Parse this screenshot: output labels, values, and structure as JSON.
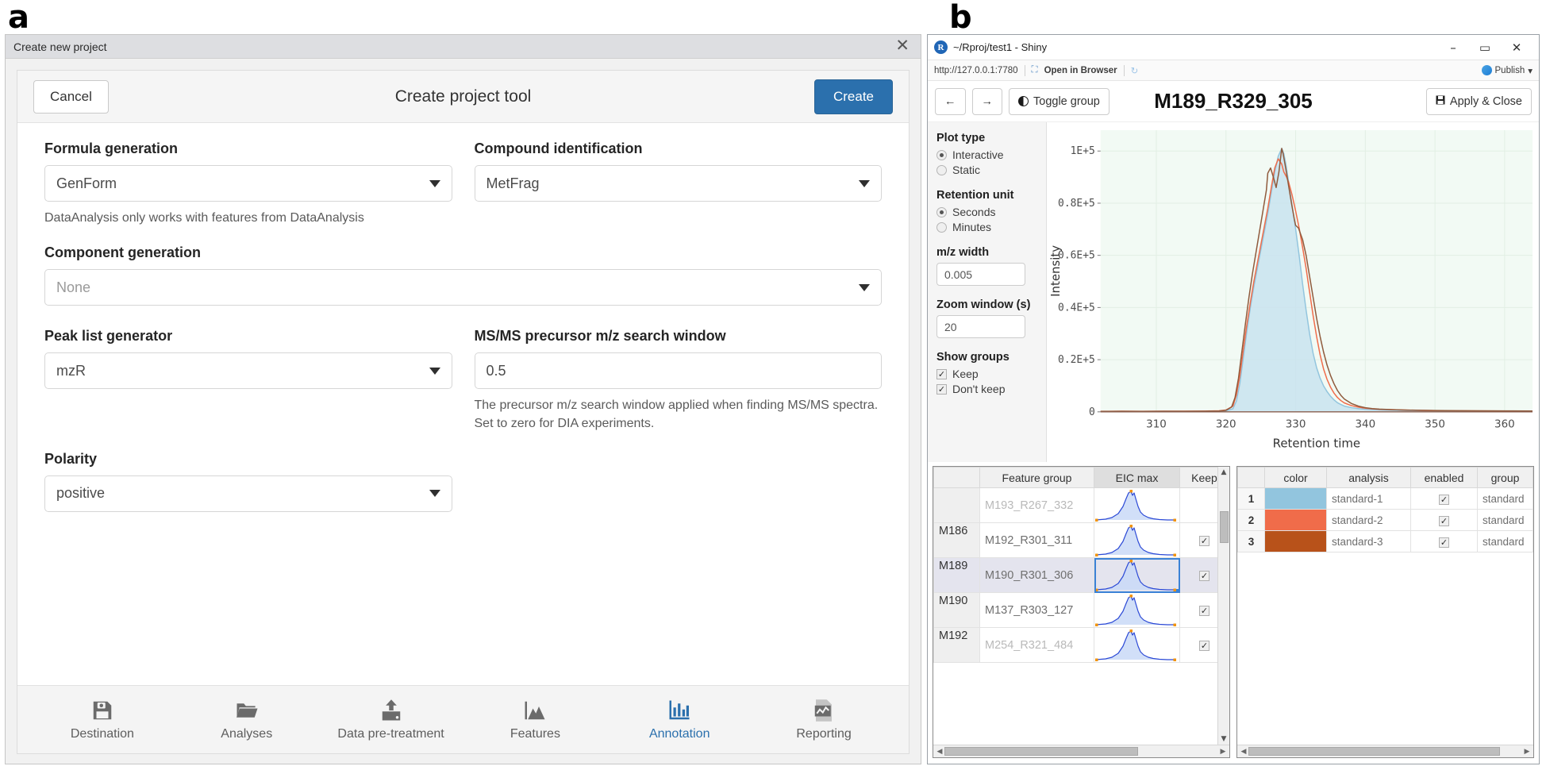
{
  "figure": {
    "label_a": "a",
    "label_b": "b"
  },
  "panel_a": {
    "window_title": "Create new project",
    "close_icon": "close-icon",
    "toolbar": {
      "cancel_label": "Cancel",
      "title": "Create project tool",
      "create_label": "Create"
    },
    "fields": {
      "formula_generation": {
        "label": "Formula generation",
        "value": "GenForm",
        "hint": "DataAnalysis only works with features from DataAnalysis"
      },
      "compound_identification": {
        "label": "Compound identification",
        "value": "MetFrag"
      },
      "component_generation": {
        "label": "Component generation",
        "value": "None"
      },
      "peak_list_generator": {
        "label": "Peak list generator",
        "value": "mzR"
      },
      "msms_precursor_window": {
        "label": "MS/MS precursor m/z search window",
        "value": "0.5",
        "hint": "The precursor m/z search window applied when finding MS/MS spectra. Set to zero for DIA experiments."
      },
      "polarity": {
        "label": "Polarity",
        "value": "positive"
      }
    },
    "bottom_tabs": [
      {
        "label": "Destination",
        "icon": "save-disk-icon",
        "active": false
      },
      {
        "label": "Analyses",
        "icon": "folder-open-icon",
        "active": false
      },
      {
        "label": "Data pre-treatment",
        "icon": "upload-icon",
        "active": false
      },
      {
        "label": "Features",
        "icon": "mountain-chart-icon",
        "active": false
      },
      {
        "label": "Annotation",
        "icon": "bar-chart-icon",
        "active": true
      },
      {
        "label": "Reporting",
        "icon": "report-document-icon",
        "active": false
      }
    ],
    "accent_color": "#2b70ad"
  },
  "panel_b": {
    "window_title": "~/Rproj/test1 - Shiny",
    "app_icon": "r-logo-icon",
    "window_controls": {
      "minimize": "–",
      "maximize": "▭",
      "close": "✕"
    },
    "url_bar": {
      "url": "http://127.0.0.1:7780",
      "open_in_browser": "Open in Browser",
      "refresh_icon": "refresh-icon",
      "publish_label": "Publish",
      "publish_caret": "▾"
    },
    "app_toolbar": {
      "back_icon": "←",
      "forward_icon": "→",
      "toggle_group_label": "Toggle group",
      "toggle_group_icon": "half-circle-icon",
      "title": "M189_R329_305",
      "apply_close_label": "Apply & Close",
      "apply_close_icon": "save-icon"
    },
    "sidebar": {
      "plot_type": {
        "heading": "Plot type",
        "options": [
          {
            "label": "Interactive",
            "selected": true
          },
          {
            "label": "Static",
            "selected": false
          }
        ]
      },
      "retention_unit": {
        "heading": "Retention unit",
        "options": [
          {
            "label": "Seconds",
            "selected": true
          },
          {
            "label": "Minutes",
            "selected": false
          }
        ]
      },
      "mz_width": {
        "heading": "m/z width",
        "value": "0.005"
      },
      "zoom_window": {
        "heading": "Zoom window (s)",
        "value": "20"
      },
      "show_groups": {
        "heading": "Show groups",
        "options": [
          {
            "label": "Keep",
            "checked": true
          },
          {
            "label": "Don't keep",
            "checked": true
          }
        ]
      }
    },
    "feature_table": {
      "columns": [
        "",
        "Feature group",
        "EIC max",
        "Keep"
      ],
      "selected_column": "EIC max",
      "rows": [
        {
          "group": "",
          "name": "M193_R267_332",
          "keep": false,
          "selected": false,
          "partial": true
        },
        {
          "group": "M186",
          "name": "M192_R301_311",
          "keep": true,
          "selected": false
        },
        {
          "group": "M189",
          "name": "M190_R301_306",
          "keep": true,
          "selected": true
        },
        {
          "group": "M190",
          "name": "M137_R303_127",
          "keep": true,
          "selected": false
        },
        {
          "group": "M192",
          "name": "M254_R321_484",
          "keep": true,
          "selected": false,
          "partial": true
        }
      ]
    },
    "analysis_table": {
      "columns": [
        "",
        "color",
        "analysis",
        "enabled",
        "group"
      ],
      "rows": [
        {
          "index": "1",
          "color": "#92c5de",
          "analysis": "standard-1",
          "enabled": true,
          "group": "standard"
        },
        {
          "index": "2",
          "color": "#f06c4a",
          "analysis": "standard-2",
          "enabled": true,
          "group": "standard"
        },
        {
          "index": "3",
          "color": "#b8521a",
          "analysis": "standard-3",
          "enabled": true,
          "group": "standard"
        }
      ]
    },
    "chart_data": {
      "type": "line",
      "title": "",
      "xlabel": "Retention time",
      "ylabel": "Intensity",
      "xlim": [
        302,
        364
      ],
      "ylim": [
        0,
        108000
      ],
      "xticks": [
        310,
        320,
        330,
        340,
        350,
        360
      ],
      "yticks": [
        0,
        20000,
        40000,
        60000,
        80000,
        100000
      ],
      "ytick_labels": [
        "0",
        "0.2E+5",
        "0.4E+5",
        "0.6E+5",
        "0.8E+5",
        "1E+5"
      ],
      "grid": true,
      "plot_bgcolor": "#f2faf4",
      "legend": "none",
      "series": [
        {
          "name": "standard-1",
          "color": "#92c5de",
          "fill": "#c9e3ef",
          "x": [
            302,
            305,
            308,
            311,
            314,
            317,
            319,
            320,
            321,
            321.5,
            322,
            322.5,
            323,
            323.5,
            324,
            324.5,
            325,
            325.5,
            326,
            326.5,
            327,
            327.5,
            328,
            328.3,
            328.6,
            329,
            329.5,
            330,
            330.5,
            331,
            331.5,
            332,
            332.5,
            333,
            333.5,
            334,
            334.5,
            335,
            335.5,
            336,
            336.5,
            337,
            338,
            339,
            340,
            341,
            342,
            344,
            346,
            348,
            350,
            353,
            356,
            360,
            364
          ],
          "y": [
            150,
            180,
            160,
            200,
            180,
            220,
            260,
            400,
            1200,
            4200,
            11000,
            21000,
            31000,
            40000,
            48000,
            55000,
            62000,
            69000,
            76000,
            84000,
            92000,
            98000,
            101000,
            99000,
            95000,
            88000,
            79000,
            70000,
            60000,
            49000,
            39000,
            30000,
            22500,
            17000,
            13000,
            10000,
            7800,
            6000,
            4600,
            3500,
            2800,
            2200,
            1600,
            1250,
            1000,
            850,
            750,
            620,
            520,
            450,
            400,
            360,
            330,
            300,
            280
          ]
        },
        {
          "name": "standard-2",
          "color": "#f06c4a",
          "x": [
            302,
            305,
            308,
            311,
            314,
            317,
            319,
            320,
            321,
            321.5,
            322,
            322.5,
            323,
            323.5,
            324,
            324.5,
            325,
            325.5,
            326,
            326.5,
            327,
            327.5,
            328,
            328.3,
            328.7,
            329,
            329.5,
            330,
            330.5,
            331,
            331.5,
            332,
            332.5,
            333,
            333.5,
            334,
            334.5,
            335,
            335.5,
            336,
            336.5,
            337,
            338,
            339,
            340,
            341,
            342,
            344,
            346,
            348,
            350,
            353,
            356,
            360,
            364
          ],
          "y": [
            200,
            230,
            210,
            250,
            240,
            300,
            420,
            700,
            2200,
            6500,
            14000,
            24000,
            33500,
            42000,
            50000,
            57000,
            64000,
            71000,
            78000,
            86000,
            93500,
            97000,
            95000,
            92000,
            90000,
            88000,
            83000,
            77000,
            70500,
            63000,
            55000,
            46000,
            37000,
            29000,
            22000,
            16500,
            12500,
            9500,
            7200,
            5500,
            4300,
            3400,
            2400,
            1800,
            1400,
            1150,
            980,
            800,
            660,
            560,
            480,
            420,
            380,
            340,
            310
          ]
        },
        {
          "name": "standard-3",
          "color": "#8f5a3c",
          "x": [
            302,
            305,
            308,
            311,
            314,
            317,
            319,
            320,
            320.8,
            321.3,
            321.8,
            322.3,
            322.8,
            323.3,
            323.8,
            324.3,
            324.8,
            325.3,
            325.8,
            326,
            326.4,
            326.8,
            327.2,
            327.6,
            328,
            328.2,
            328.6,
            329,
            329.4,
            329.8,
            330,
            330.4,
            331,
            331.5,
            332,
            332.5,
            333,
            333.5,
            334,
            334.5,
            335,
            335.5,
            336,
            336.5,
            337,
            338,
            339,
            340,
            341,
            342,
            344,
            346,
            348,
            350,
            353,
            356,
            360,
            364
          ],
          "y": [
            170,
            200,
            185,
            215,
            205,
            250,
            330,
            600,
            1800,
            5500,
            13000,
            23500,
            34000,
            44000,
            53000,
            61000,
            69000,
            77000,
            85000,
            91500,
            93500,
            90000,
            86000,
            92000,
            101000,
            99000,
            93000,
            86500,
            80000,
            74000,
            71500,
            70500,
            66000,
            60000,
            52000,
            44000,
            36000,
            29000,
            23000,
            18000,
            14000,
            10800,
            8200,
            6300,
            4900,
            3200,
            2200,
            1600,
            1250,
            1050,
            820,
            680,
            580,
            500,
            440,
            400,
            360,
            330
          ]
        }
      ]
    }
  }
}
